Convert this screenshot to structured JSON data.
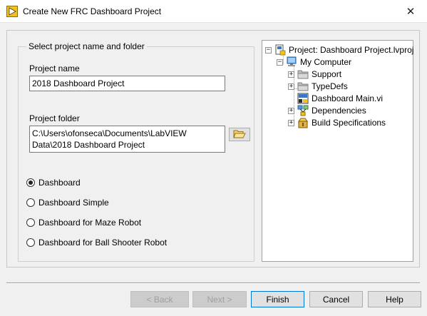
{
  "window": {
    "title": "Create New FRC Dashboard Project",
    "close_glyph": "✕"
  },
  "form": {
    "group_label": "Select project name and folder",
    "project_name_label": "Project name",
    "project_name_value": "2018 Dashboard Project",
    "project_folder_label": "Project folder",
    "project_folder_value": "C:\\Users\\ofonseca\\Documents\\LabVIEW Data\\2018 Dashboard Project",
    "templates": [
      {
        "label": "Dashboard",
        "selected": true
      },
      {
        "label": "Dashboard Simple",
        "selected": false
      },
      {
        "label": "Dashboard for Maze Robot",
        "selected": false
      },
      {
        "label": "Dashboard for Ball Shooter Robot",
        "selected": false
      }
    ]
  },
  "tree": {
    "project": {
      "label": "Project: Dashboard Project.lvproj",
      "icon": "lvproj-icon",
      "expander": "−"
    },
    "computer": {
      "label": "My Computer",
      "icon": "computer-icon",
      "expander": "−"
    },
    "items": [
      {
        "label": "Support",
        "icon": "folder-icon",
        "expander": "+"
      },
      {
        "label": "TypeDefs",
        "icon": "folder-icon",
        "expander": "+"
      },
      {
        "label": "Dashboard Main.vi",
        "icon": "vi-icon",
        "expander": ""
      },
      {
        "label": "Dependencies",
        "icon": "dependencies-icon",
        "expander": "+"
      },
      {
        "label": "Build Specifications",
        "icon": "build-specifications-icon",
        "expander": "+"
      }
    ]
  },
  "buttons": {
    "back": "< Back",
    "next": "Next >",
    "finish": "Finish",
    "cancel": "Cancel",
    "help": "Help"
  },
  "colors": {
    "accent": "#0078d7",
    "folder": "#f5d06b"
  }
}
